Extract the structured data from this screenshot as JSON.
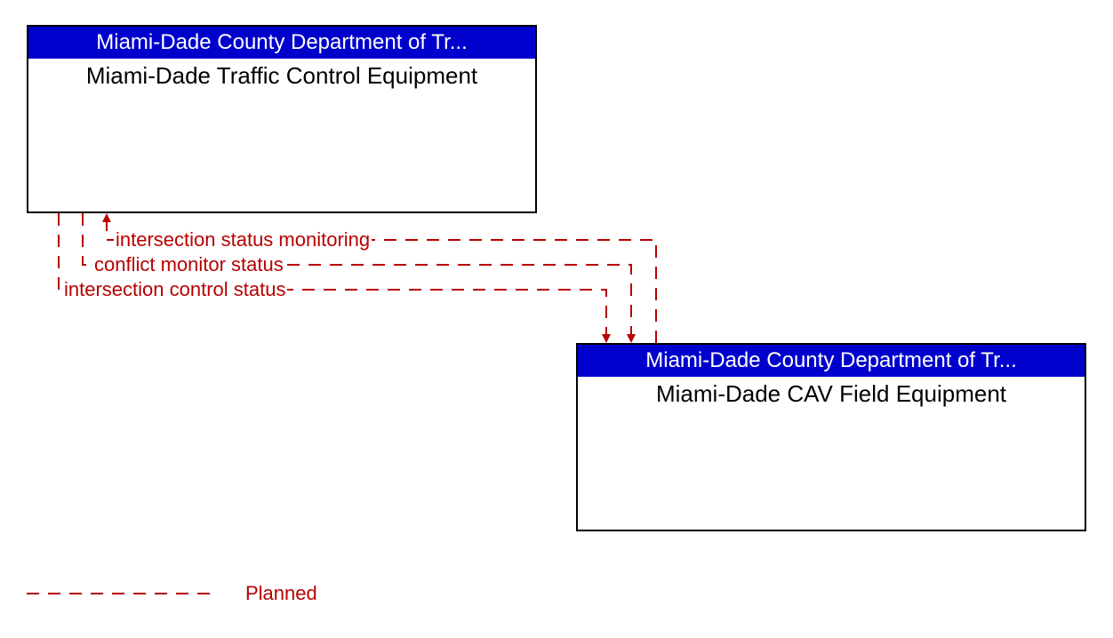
{
  "top_box": {
    "header": "Miami-Dade County Department of Tr...",
    "body": "Miami-Dade Traffic Control Equipment"
  },
  "bottom_box": {
    "header": "Miami-Dade County Department of Tr...",
    "body": "Miami-Dade CAV Field Equipment"
  },
  "flows": {
    "flow1": "intersection status monitoring",
    "flow2": "conflict monitor status",
    "flow3": "intersection control status"
  },
  "legend": {
    "planned": "Planned"
  },
  "colors": {
    "header_bg": "#0000cc",
    "flow": "#b80000"
  }
}
